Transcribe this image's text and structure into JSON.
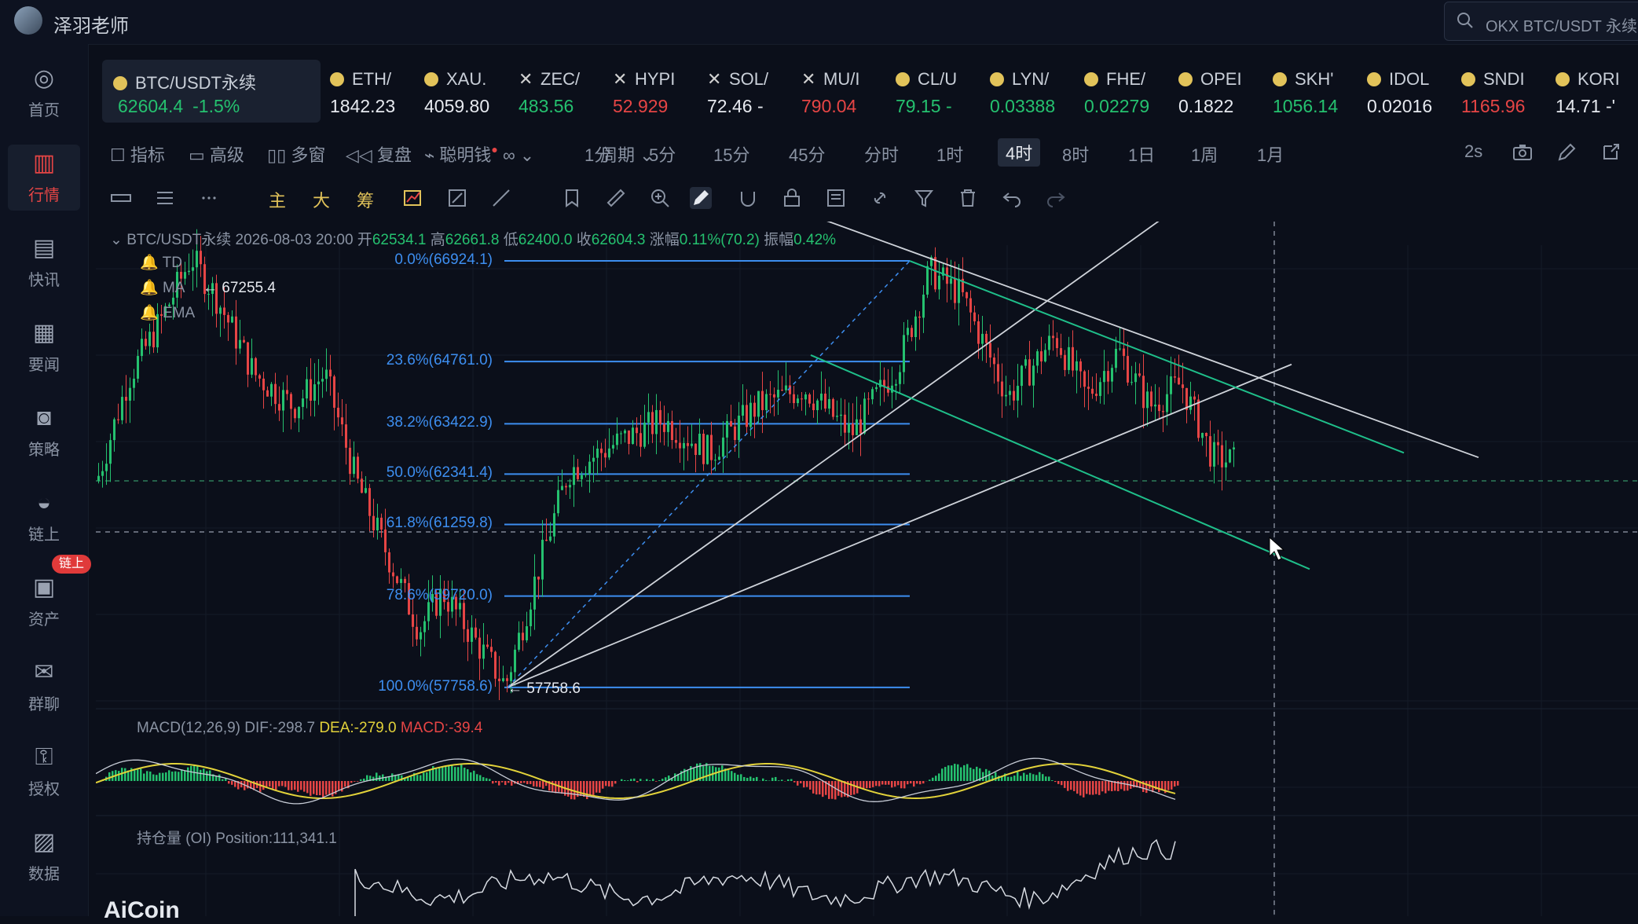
{
  "header": {
    "user_name": "泽羽老师",
    "search_text": "OKX BTC/USDT 永续"
  },
  "sidebar": {
    "items": [
      {
        "label": "首页",
        "icon": "home-icon"
      },
      {
        "label": "行情",
        "icon": "market-chart-icon"
      },
      {
        "label": "快讯",
        "icon": "news-flash-icon"
      },
      {
        "label": "要闻",
        "icon": "headline-icon"
      },
      {
        "label": "策略",
        "icon": "robot-strategy-icon"
      },
      {
        "label": "链上",
        "icon": "onchain-icon"
      },
      {
        "label": "资产",
        "icon": "wallet-icon"
      },
      {
        "label": "群聊",
        "icon": "chat-icon"
      },
      {
        "label": "授权",
        "icon": "key-icon"
      },
      {
        "label": "数据",
        "icon": "data-icon"
      }
    ],
    "badge": "链上"
  },
  "tickers": [
    {
      "symbol": "BTC/USDT永续",
      "value": "62604.4",
      "change": "-1.5%",
      "color": "#25c16f",
      "mark": "dot"
    },
    {
      "symbol": "ETH/",
      "value": "1842.23",
      "color": "#e6e9ef",
      "mark": "dot"
    },
    {
      "symbol": "XAU.",
      "value": "4059.80",
      "color": "#e6e9ef",
      "mark": "dot"
    },
    {
      "symbol": "ZEC/",
      "value": "483.56",
      "color": "#25c16f",
      "mark": "x"
    },
    {
      "symbol": "HYPI",
      "value": "52.929",
      "color": "#e64545",
      "mark": "x"
    },
    {
      "symbol": "SOL/",
      "value": "72.46 -",
      "color": "#e6e9ef",
      "mark": "x"
    },
    {
      "symbol": "MU/I",
      "value": "790.04",
      "color": "#e64545",
      "mark": "x"
    },
    {
      "symbol": "CL/U",
      "value": "79.15 -",
      "color": "#25c16f",
      "mark": "dot"
    },
    {
      "symbol": "LYN/",
      "value": "0.03388",
      "color": "#25c16f",
      "mark": "dot"
    },
    {
      "symbol": "FHE/",
      "value": "0.02279",
      "color": "#25c16f",
      "mark": "dot"
    },
    {
      "symbol": "OPEI",
      "value": "0.1822",
      "color": "#e6e9ef",
      "mark": "dot"
    },
    {
      "symbol": "SKH'",
      "value": "1056.14",
      "color": "#25c16f",
      "mark": "dot"
    },
    {
      "symbol": "IDOL",
      "value": "0.02016",
      "color": "#e6e9ef",
      "mark": "dot"
    },
    {
      "symbol": "SNDI",
      "value": "1165.96",
      "color": "#e64545",
      "mark": "dot"
    },
    {
      "symbol": "KORI",
      "value": "14.71 -'",
      "color": "#e6e9ef",
      "mark": "dot"
    }
  ],
  "toolbar": {
    "indicators": "指标",
    "advanced": "高级",
    "multi_window": "多窗",
    "replay": "复盘",
    "smart_money": "聪明钱",
    "period": "周期",
    "intervals": [
      "1分",
      "5分",
      "15分",
      "45分",
      "分时",
      "1时",
      "4时",
      "8时",
      "1日",
      "1周",
      "1月"
    ],
    "active_interval": "4时",
    "refresh": "2s"
  },
  "drawbar": {
    "main": "主",
    "big": "大",
    "chips": "筹"
  },
  "chart": {
    "info": {
      "symbol": "BTC/USDT永续",
      "datetime": "2026-08-03 20:00",
      "open_label": "开",
      "open": "62534.1",
      "high_label": "高",
      "high": "62661.8",
      "low_label": "低",
      "low": "62400.0",
      "close_label": "收",
      "close": "62604.3",
      "change_label": "涨幅",
      "change": "0.11%(70.2)",
      "amp_label": "振幅",
      "amp": "0.42%"
    },
    "legends": [
      "TD",
      "MA",
      "EMA"
    ],
    "high_mark": "67255.4",
    "low_mark": "57758.6",
    "fib_levels": [
      {
        "label": "0.0%(66924.1)",
        "price": 66924.1
      },
      {
        "label": "23.6%(64761.0)",
        "price": 64761.0
      },
      {
        "label": "38.2%(63422.9)",
        "price": 63422.9
      },
      {
        "label": "50.0%(62341.4)",
        "price": 62341.4
      },
      {
        "label": "61.8%(61259.8)",
        "price": 61259.8
      },
      {
        "label": "78.6%(59720.0)",
        "price": 59720.0
      },
      {
        "label": "100.0%(57758.6)",
        "price": 57758.6
      }
    ],
    "colors": {
      "up": "#25c16f",
      "down": "#e64545",
      "fib": "#3d8ef0",
      "channel": "#1fbf8a"
    },
    "macd": {
      "title": "MACD(12,26,9)",
      "dif": "DIF:-298.7",
      "dea": "DEA:-279.0",
      "macd": "MACD:-39.4"
    },
    "oi": {
      "title": "持仓量 (OI)",
      "position": "Position:111,341.1"
    },
    "watermark": "AiCoin"
  }
}
